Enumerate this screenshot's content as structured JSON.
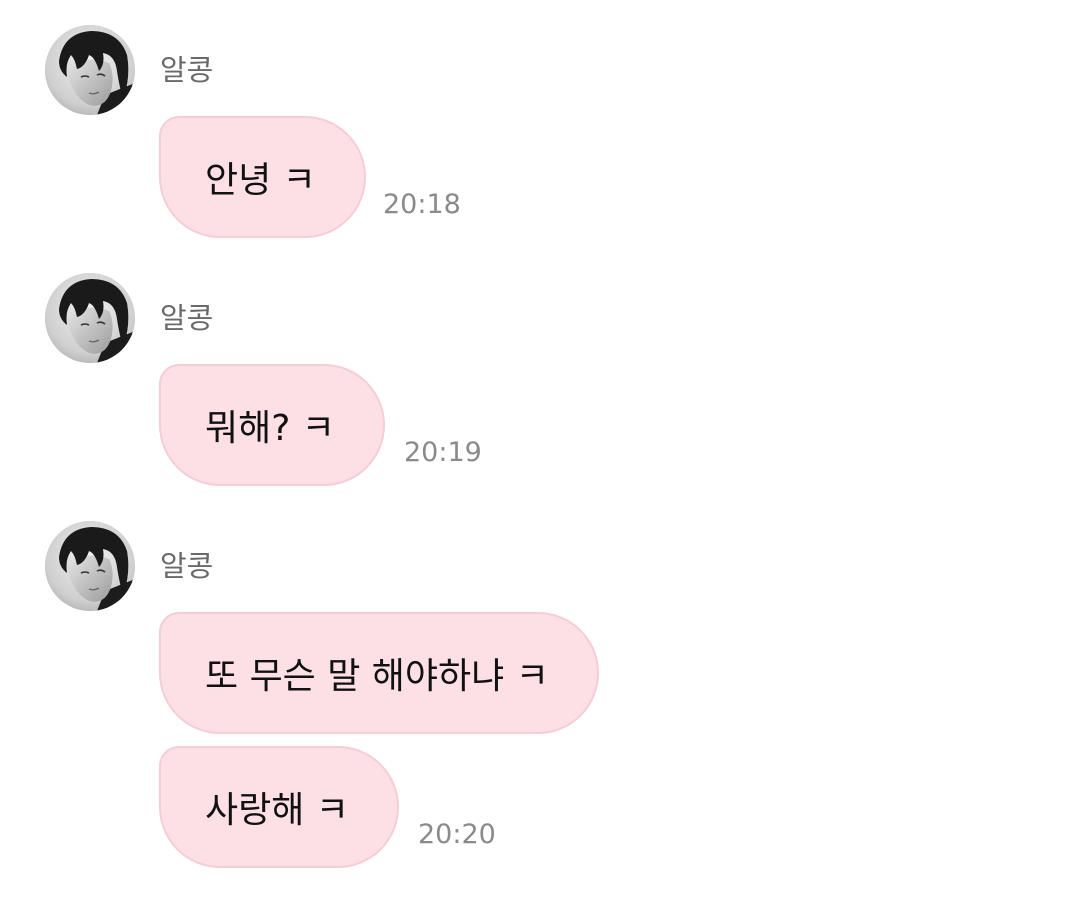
{
  "chat": {
    "groups": [
      {
        "sender": "알콩",
        "messages": [
          {
            "text": "안녕 ㅋ",
            "time": "20:18"
          }
        ]
      },
      {
        "sender": "알콩",
        "messages": [
          {
            "text": "뭐해? ㅋ",
            "time": "20:19"
          }
        ]
      },
      {
        "sender": "알콩",
        "messages": [
          {
            "text": "또 무슨 말 해야하냐 ㅋ",
            "time": ""
          },
          {
            "text": "사랑해 ㅋ",
            "time": "20:20"
          }
        ]
      }
    ]
  },
  "colors": {
    "bubble_background": "#fde0e6",
    "bubble_border": "#f5cdd5",
    "sender_name": "#6a6a6a",
    "timestamp": "#8a8a8a"
  },
  "icons": {
    "avatar": "profile-photo-grayscale-portrait"
  }
}
